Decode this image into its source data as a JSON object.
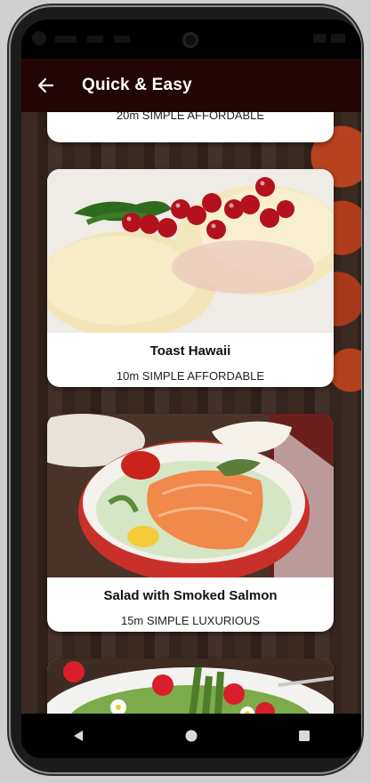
{
  "app_bar": {
    "title": "Quick & Easy",
    "back_icon": "arrow-back-icon"
  },
  "meals": [
    {
      "title": "",
      "meta": "20m SIMPLE AFFORDABLE",
      "image": "partially-hidden-meal-photo"
    },
    {
      "title": "Toast Hawaii",
      "meta": "10m SIMPLE AFFORDABLE",
      "image": "toast-hawaii-photo"
    },
    {
      "title": "Salad with Smoked Salmon",
      "meta": "15m SIMPLE LUXURIOUS",
      "image": "smoked-salmon-salad-photo"
    },
    {
      "title": "",
      "meta": "",
      "image": "asparagus-strawberry-salad-photo"
    }
  ],
  "nav": {
    "back": "triangle-back-icon",
    "home": "circle-home-icon",
    "recents": "square-recents-icon"
  },
  "colors": {
    "app_bar": "#210605",
    "card": "#ffffff",
    "system_bar": "#000000"
  }
}
